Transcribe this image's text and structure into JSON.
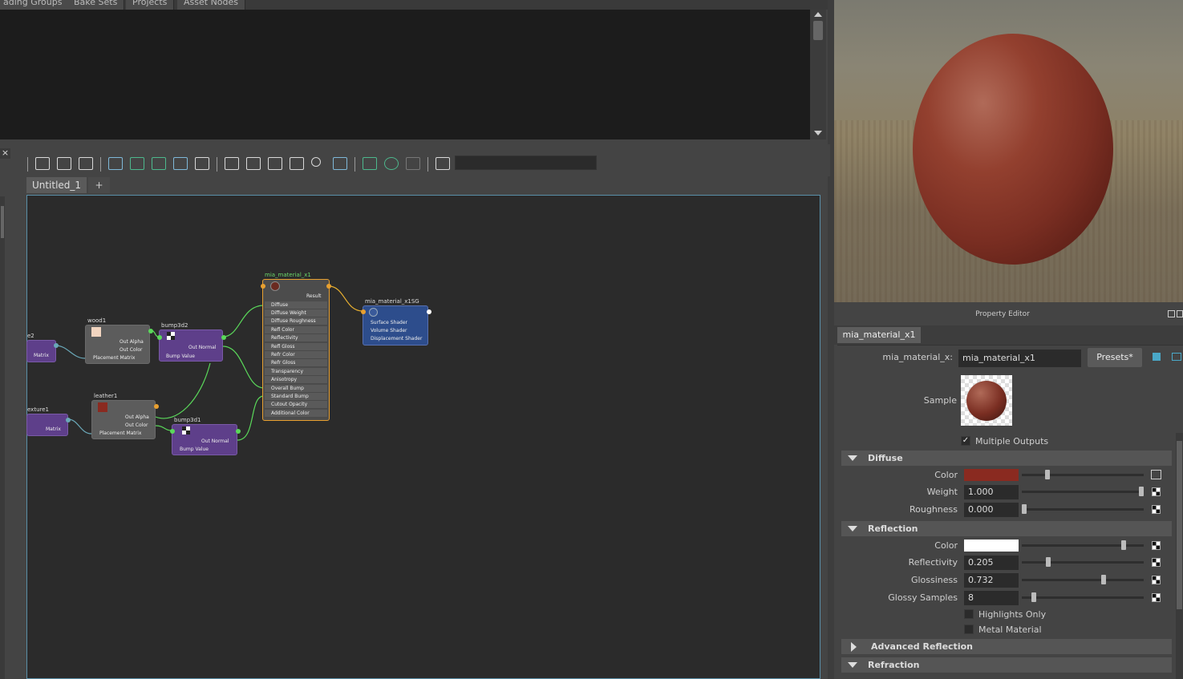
{
  "top_tabs": [
    "ading Groups",
    "Bake Sets",
    "Projects",
    "Asset Nodes"
  ],
  "graph_tabs": {
    "active": "Untitled_1",
    "add": "+"
  },
  "close_glyph": "×",
  "nodes": {
    "place2d_a": {
      "title": "e2",
      "attrs": [
        "Matrix"
      ]
    },
    "wood1": {
      "title": "wood1",
      "attrs": [
        "Out Alpha",
        "Out Color",
        "Placement Matrix"
      ]
    },
    "bump3d2": {
      "title": "bump3d2",
      "attrs": [
        "Out Normal",
        "Bump Value"
      ]
    },
    "place2d_b": {
      "title": "exture1",
      "attrs": [
        "Matrix"
      ]
    },
    "leather1": {
      "title": "leather1",
      "attrs": [
        "Out Alpha",
        "Out Color",
        "Placement Matrix"
      ]
    },
    "bump3d1": {
      "title": "bump3d1",
      "attrs": [
        "Out Normal",
        "Bump Value"
      ]
    },
    "mia_material_x1": {
      "title": "mia_material_x1",
      "result": "Result",
      "attrs": [
        "Diffuse",
        "Diffuse Weight",
        "Diffuse Roughness",
        "Refl Color",
        "Reflectivity",
        "Refl Gloss",
        "Refr Color",
        "Refr Gloss",
        "Transparency",
        "Anisotropy",
        "Overall Bump",
        "Standard Bump",
        "Cutout Opacity",
        "Additional Color"
      ]
    },
    "mia_material_x1SG": {
      "title": "mia_material_x1SG",
      "attrs": [
        "Surface Shader",
        "Volume Shader",
        "Displacement Shader"
      ]
    }
  },
  "property_editor": {
    "title": "Property Editor",
    "tab": "mia_material_x1",
    "node_label": "mia_material_x:",
    "node_name": "mia_material_x1",
    "presets_button": "Presets*",
    "sample_label": "Sample",
    "multiple_outputs": {
      "label": "Multiple Outputs",
      "checked": true
    },
    "sections": {
      "diffuse": {
        "title": "Diffuse",
        "rows": [
          {
            "label": "Color",
            "value": "",
            "color": "#8a2a20",
            "level": 0.2
          },
          {
            "label": "Weight",
            "value": "1.000",
            "level": 1.0
          },
          {
            "label": "Roughness",
            "value": "0.000",
            "level": 0.0
          }
        ]
      },
      "reflection": {
        "title": "Reflection",
        "rows": [
          {
            "label": "Color",
            "value": "",
            "color": "#ffffff",
            "level": 0.85
          },
          {
            "label": "Reflectivity",
            "value": "0.205",
            "level": 0.205
          },
          {
            "label": "Glossiness",
            "value": "0.732",
            "level": 0.68
          },
          {
            "label": "Glossy Samples",
            "value": "8",
            "level": 0.08
          }
        ],
        "checkboxes": [
          "Highlights Only",
          "Metal Material"
        ]
      },
      "advanced_reflection": {
        "title": "Advanced Reflection"
      },
      "refraction": {
        "title": "Refraction"
      }
    }
  }
}
